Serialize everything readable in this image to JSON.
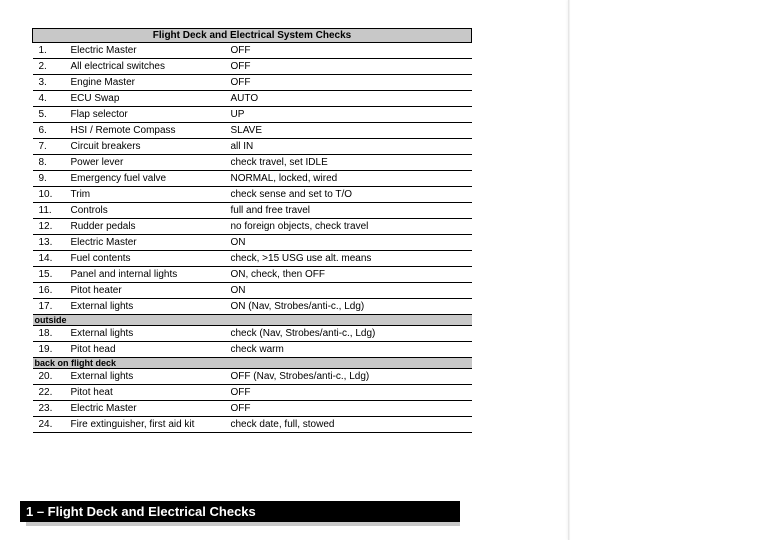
{
  "title": "Flight Deck and Electrical System Checks",
  "footer": "1 – Flight Deck and Electrical Checks",
  "section1_label": "outside",
  "section2_label": "back on flight deck",
  "items_main": [
    {
      "n": "1.",
      "item": "Electric Master",
      "val": "OFF"
    },
    {
      "n": "2.",
      "item": "All electrical switches",
      "val": "OFF"
    },
    {
      "n": "3.",
      "item": "Engine Master",
      "val": "OFF"
    },
    {
      "n": "4.",
      "item": "ECU Swap",
      "val": "AUTO"
    },
    {
      "n": "5.",
      "item": "Flap selector",
      "val": "UP"
    },
    {
      "n": "6.",
      "item": "HSI / Remote Compass",
      "val": "SLAVE"
    },
    {
      "n": "7.",
      "item": "Circuit breakers",
      "val": "all IN"
    },
    {
      "n": "8.",
      "item": "Power lever",
      "val": "check travel, set IDLE"
    },
    {
      "n": "9.",
      "item": "Emergency fuel valve",
      "val": "NORMAL, locked, wired"
    },
    {
      "n": "10.",
      "item": "Trim",
      "val": "check sense and set to T/O"
    },
    {
      "n": "11.",
      "item": "Controls",
      "val": "full and free travel"
    },
    {
      "n": "12.",
      "item": "Rudder pedals",
      "val": "no foreign objects, check travel"
    },
    {
      "n": "13.",
      "item": "Electric Master",
      "val": "ON"
    },
    {
      "n": "14.",
      "item": "Fuel contents",
      "val": "check, >15 USG use alt. means"
    },
    {
      "n": "15.",
      "item": "Panel and internal lights",
      "val": "ON, check, then OFF"
    },
    {
      "n": "16.",
      "item": "Pitot heater",
      "val": "ON"
    },
    {
      "n": "17.",
      "item": "External lights",
      "val": "ON (Nav, Strobes/anti-c., Ldg)"
    }
  ],
  "items_outside": [
    {
      "n": "18.",
      "item": "External lights",
      "val": "check (Nav, Strobes/anti-c., Ldg)"
    },
    {
      "n": "19.",
      "item": "Pitot head",
      "val": "check warm"
    }
  ],
  "items_back": [
    {
      "n": "20.",
      "item": "External lights",
      "val": "OFF (Nav, Strobes/anti-c., Ldg)"
    },
    {
      "n": "22.",
      "item": "Pitot heat",
      "val": "OFF"
    },
    {
      "n": "23.",
      "item": "Electric Master",
      "val": "OFF"
    },
    {
      "n": "24.",
      "item": "Fire extinguisher, first aid kit",
      "val": "check date, full, stowed"
    }
  ]
}
